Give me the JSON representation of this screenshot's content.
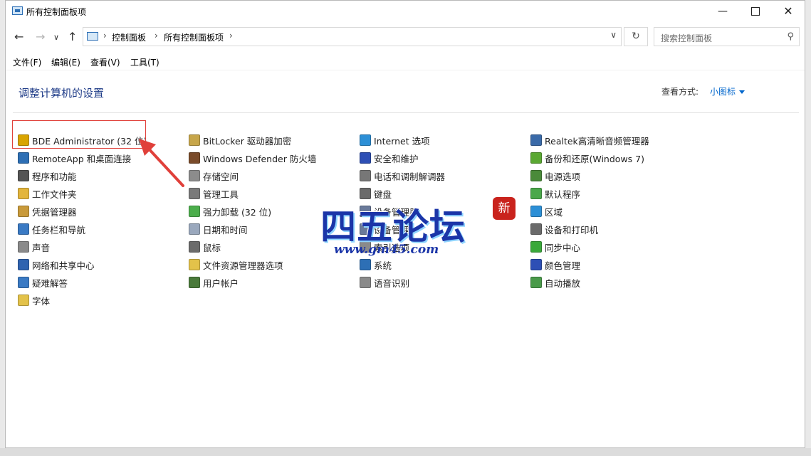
{
  "window": {
    "title": "所有控制面板项"
  },
  "address": {
    "crumbs": [
      "控制面板",
      "所有控制面板项"
    ],
    "search_placeholder": "搜索控制面板"
  },
  "menu": [
    "文件(F)",
    "编辑(E)",
    "查看(V)",
    "工具(T)"
  ],
  "page": {
    "title": "调整计算机的设置",
    "view_by_label": "查看方式:",
    "view_by_value": "小图标"
  },
  "columns": [
    [
      {
        "label": "BDE Administrator (32 位)",
        "icon": "bde-icon",
        "color": "#d9a400"
      },
      {
        "label": "RemoteApp 和桌面连接",
        "icon": "remoteapp-icon",
        "color": "#2d6fb5"
      },
      {
        "label": "程序和功能",
        "icon": "programs-icon",
        "color": "#555555"
      },
      {
        "label": "工作文件夹",
        "icon": "work-folders-icon",
        "color": "#e3b53b"
      },
      {
        "label": "凭据管理器",
        "icon": "credential-icon",
        "color": "#c99a3a"
      },
      {
        "label": "任务栏和导航",
        "icon": "taskbar-icon",
        "color": "#3a7ac4"
      },
      {
        "label": "声音",
        "icon": "sound-icon",
        "color": "#8a8a8a"
      },
      {
        "label": "网络和共享中心",
        "icon": "network-icon",
        "color": "#2f63b0"
      },
      {
        "label": "疑难解答",
        "icon": "troubleshoot-icon",
        "color": "#3a7ac4"
      },
      {
        "label": "字体",
        "icon": "fonts-icon",
        "color": "#e3c24a"
      }
    ],
    [
      {
        "label": "BitLocker 驱动器加密",
        "icon": "bitlocker-icon",
        "color": "#c7a64a"
      },
      {
        "label": "Windows Defender 防火墙",
        "icon": "firewall-icon",
        "color": "#7a4b2a"
      },
      {
        "label": "存储空间",
        "icon": "storage-icon",
        "color": "#8c8c8c"
      },
      {
        "label": "管理工具",
        "icon": "admin-tools-icon",
        "color": "#7a7a7a"
      },
      {
        "label": "强力卸载 (32 位)",
        "icon": "uninstall-icon",
        "color": "#4cae4c"
      },
      {
        "label": "日期和时间",
        "icon": "datetime-icon",
        "color": "#9aa8bd"
      },
      {
        "label": "鼠标",
        "icon": "mouse-icon",
        "color": "#6c6c6c"
      },
      {
        "label": "文件资源管理器选项",
        "icon": "explorer-options-icon",
        "color": "#e3c24a"
      },
      {
        "label": "用户帐户",
        "icon": "user-accounts-icon",
        "color": "#4a7a3a"
      }
    ],
    [
      {
        "label": "Internet 选项",
        "icon": "internet-icon",
        "color": "#2c8fd6"
      },
      {
        "label": "安全和维护",
        "icon": "security-icon",
        "color": "#2d4fb5"
      },
      {
        "label": "电话和调制解调器",
        "icon": "phone-modem-icon",
        "color": "#777777"
      },
      {
        "label": "键盘",
        "icon": "keyboard-icon",
        "color": "#6a6a6a"
      },
      {
        "label": "设备管理器",
        "icon": "device-manager-icon",
        "color": "#6a7a9a"
      },
      {
        "label": "设备管理",
        "icon": "device-mgmt-icon",
        "color": "#6a7a9a"
      },
      {
        "label": "索引选项",
        "icon": "indexing-icon",
        "color": "#8a8a8a"
      },
      {
        "label": "系统",
        "icon": "system-icon",
        "color": "#2d6fb5"
      },
      {
        "label": "语音识别",
        "icon": "speech-icon",
        "color": "#8a8a8a"
      }
    ],
    [
      {
        "label": "Realtek高清晰音频管理器",
        "icon": "realtek-icon",
        "color": "#3a6aa8"
      },
      {
        "label": "备份和还原(Windows 7)",
        "icon": "backup-icon",
        "color": "#5aa832"
      },
      {
        "label": "电源选项",
        "icon": "power-icon",
        "color": "#4a8a3a"
      },
      {
        "label": "默认程序",
        "icon": "default-programs-icon",
        "color": "#4aa84a"
      },
      {
        "label": "区域",
        "icon": "region-icon",
        "color": "#2c8fd6"
      },
      {
        "label": "设备和打印机",
        "icon": "printers-icon",
        "color": "#6a6a6a"
      },
      {
        "label": "同步中心",
        "icon": "sync-icon",
        "color": "#3aa83a"
      },
      {
        "label": "颜色管理",
        "icon": "color-mgmt-icon",
        "color": "#2d4fb5"
      },
      {
        "label": "自动播放",
        "icon": "autoplay-icon",
        "color": "#4a9a4a"
      }
    ]
  ],
  "watermark": {
    "text": "四五论坛",
    "url": "www.gm45.com",
    "stamp": "新"
  }
}
